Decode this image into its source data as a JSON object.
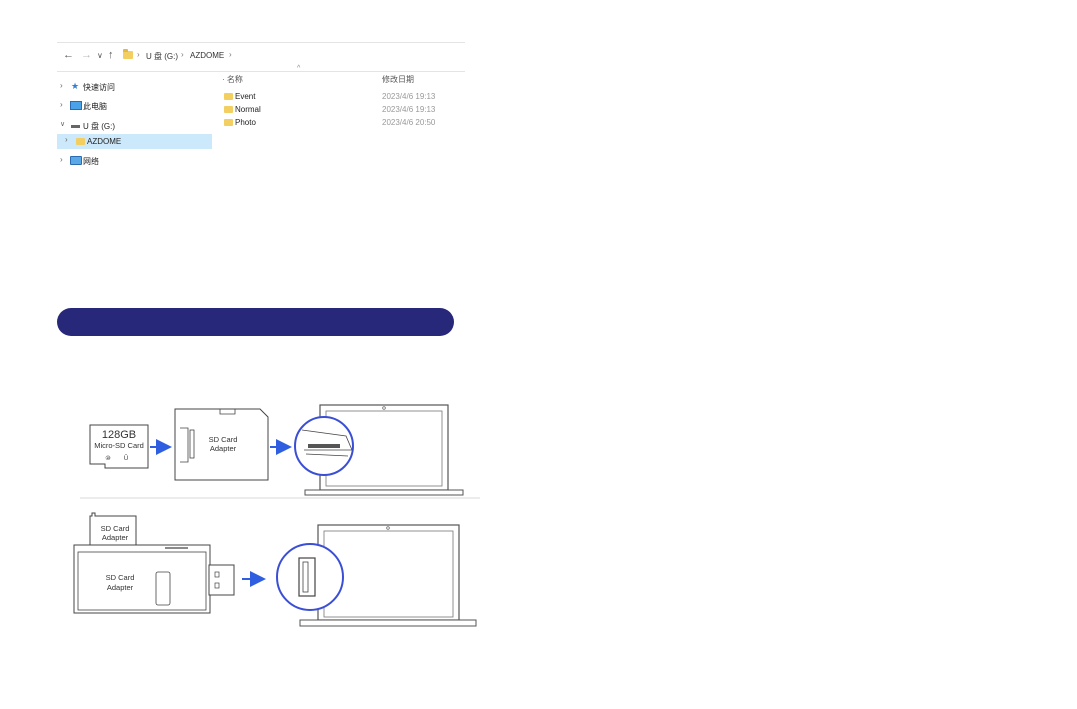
{
  "explorer": {
    "nav": {
      "back": "←",
      "forward": "→",
      "recent": "∨",
      "up": "↑"
    },
    "breadcrumb": {
      "drive": "U 盘 (G:)",
      "folder": "AZDOME"
    },
    "tree": [
      {
        "label": "快速访问",
        "icon": "star-icon"
      },
      {
        "label": "此电脑",
        "icon": "computer-icon"
      },
      {
        "label": "U 盘 (G:)",
        "icon": "drive-icon"
      },
      {
        "label": "AZDOME",
        "icon": "folder-icon"
      },
      {
        "label": "网络",
        "icon": "network-icon"
      }
    ],
    "columns": {
      "name": "名称",
      "modified": "修改日期"
    },
    "files": [
      {
        "name": "Event",
        "date": "2023/4/6 19:13"
      },
      {
        "name": "Normal",
        "date": "2023/4/6 19:13"
      },
      {
        "name": "Photo",
        "date": "2023/4/6 20:50"
      }
    ]
  },
  "illustration": {
    "card_capacity": "128GB",
    "card_type": "Micro-SD Card",
    "adapter_label_line1": "SD Card",
    "adapter_label_line2": "Adapter",
    "arrow_color": "#2f5fe0",
    "circle_color": "#3b4fd6"
  }
}
